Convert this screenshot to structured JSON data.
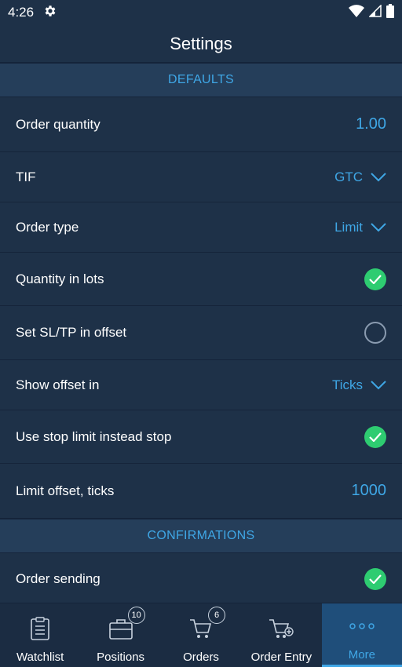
{
  "status_bar": {
    "time": "4:26"
  },
  "app_bar": {
    "title": "Settings"
  },
  "sections": {
    "defaults": "DEFAULTS",
    "confirmations": "CONFIRMATIONS"
  },
  "rows": {
    "order_quantity": {
      "label": "Order quantity",
      "value": "1.00"
    },
    "tif": {
      "label": "TIF",
      "value": "GTC"
    },
    "order_type": {
      "label": "Order type",
      "value": "Limit"
    },
    "quantity_in_lots": {
      "label": "Quantity in lots",
      "checked": true
    },
    "set_sl_tp": {
      "label": "Set SL/TP in offset",
      "checked": false
    },
    "show_offset_in": {
      "label": "Show offset in",
      "value": "Ticks"
    },
    "use_stop_limit": {
      "label": "Use stop limit instead stop",
      "checked": true
    },
    "limit_offset": {
      "label": "Limit offset, ticks",
      "value": "1000"
    },
    "order_sending": {
      "label": "Order sending",
      "checked": true
    }
  },
  "bottom_nav": {
    "watchlist": {
      "label": "Watchlist"
    },
    "positions": {
      "label": "Positions",
      "badge": "10"
    },
    "orders": {
      "label": "Orders",
      "badge": "6"
    },
    "order_entry": {
      "label": "Order Entry"
    },
    "more": {
      "label": "More"
    }
  },
  "colors": {
    "background": "#1e3148",
    "accent": "#3fa7e6",
    "check": "#2ecc71"
  }
}
